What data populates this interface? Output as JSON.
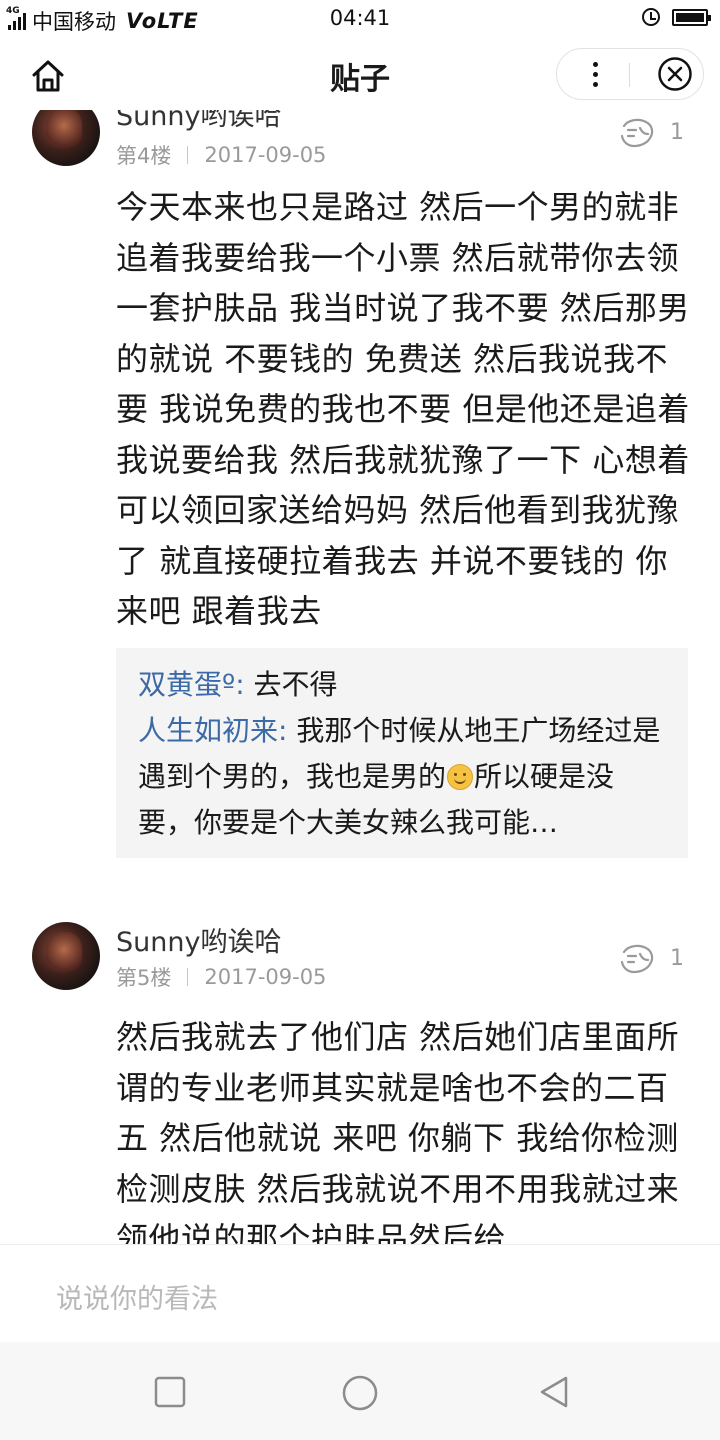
{
  "status_bar": {
    "network_tag": "4G",
    "carrier": "中国移动",
    "volte": "VoLTE",
    "time": "04:41",
    "alarm_icon": "alarm-clock-icon",
    "battery_icon": "battery-icon",
    "battery_level": 1.0
  },
  "nav": {
    "title": "贴子",
    "home_icon": "home-icon",
    "more_icon": "more-dots-icon",
    "close_icon": "close-circle-icon"
  },
  "posts": [
    {
      "username": "Sunny哟诶哈",
      "floor": "第4楼",
      "date": "2017-09-05",
      "likes": "1",
      "like_icon": "thumbs-up-icon",
      "text": "今天本来也只是路过 然后一个男的就非追着我要给我一个小票 然后就带你去领一套护肤品 我当时说了我不要 然后那男的就说 不要钱的 免费送 然后我说我不要 我说免费的我也不要 但是他还是追着我说要给我 然后我就犹豫了一下 心想着 可以领回家送给妈妈 然后他看到我犹豫了 就直接硬拉着我去 并说不要钱的 你来吧 跟着我去",
      "replies": [
        {
          "name": "双黄蛋º:",
          "text": " 去不得"
        },
        {
          "name": "人生如初来:",
          "text_before_emoji": " 我那个时候从地王广场经过是遇到个男的，我也是男的",
          "emoji": "smile-emoji-icon",
          "text_after_emoji": "所以硬是没要，你要是个大美女辣么我可能…"
        }
      ]
    },
    {
      "username": "Sunny哟诶哈",
      "floor": "第5楼",
      "date": "2017-09-05",
      "likes": "1",
      "like_icon": "thumbs-up-icon",
      "text": "然后我就去了他们店 然后她们店里面所谓的专业老师其实就是啥也不会的二百五 然后他就说 来吧 你躺下 我给你检测检测皮肤 然后我就说不用不用我就过来领他说的那个护肤品然后给"
    }
  ],
  "comment_bar": {
    "placeholder": "说说你的看法"
  },
  "system_nav": {
    "recent_icon": "square-recent-apps-icon",
    "home_icon": "circle-home-icon",
    "back_icon": "triangle-back-icon"
  }
}
